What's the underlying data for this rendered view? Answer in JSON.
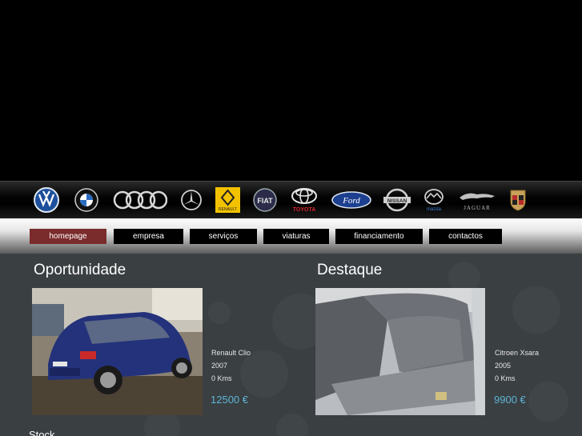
{
  "brands": [
    {
      "name": "vw-logo-icon"
    },
    {
      "name": "bmw-logo-icon"
    },
    {
      "name": "audi-logo-icon"
    },
    {
      "name": "mercedes-logo-icon"
    },
    {
      "name": "renault-logo-icon",
      "text": "RENAULT"
    },
    {
      "name": "fiat-logo-icon",
      "text": "FIAT"
    },
    {
      "name": "toyota-logo-icon",
      "text": "TOYOTA"
    },
    {
      "name": "ford-logo-icon",
      "text": "Ford"
    },
    {
      "name": "nissan-logo-icon",
      "text": "NISSAN"
    },
    {
      "name": "mazda-logo-icon",
      "text": "mazda"
    },
    {
      "name": "jaguar-logo-icon",
      "text": "JAGUAR"
    },
    {
      "name": "porsche-logo-icon"
    }
  ],
  "nav": {
    "items": [
      {
        "label": "homepage",
        "active": true
      },
      {
        "label": "empresa"
      },
      {
        "label": "serviços"
      },
      {
        "label": "viaturas"
      },
      {
        "label": "financiamento"
      },
      {
        "label": "contactos"
      }
    ]
  },
  "oportunidade": {
    "title": "Oportunidade",
    "car": "Renault Clio",
    "year": "2007",
    "kms": "0 Kms",
    "price": "12500 €"
  },
  "destaque": {
    "title": "Destaque",
    "car": "Citroen Xsara",
    "year": "2005",
    "kms": "0 Kms",
    "price": "9900 €"
  },
  "stock": {
    "title": "Stock"
  }
}
